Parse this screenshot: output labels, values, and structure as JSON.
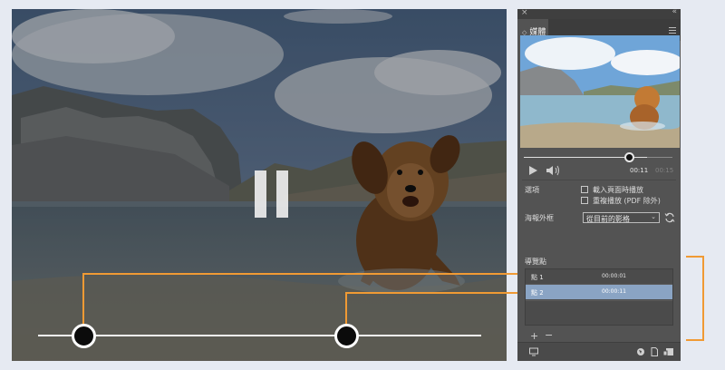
{
  "video": {
    "state": "paused",
    "timeline_markers": [
      {
        "name": "marker-1",
        "position": 0.1
      },
      {
        "name": "marker-2",
        "position": 0.69
      }
    ]
  },
  "panel": {
    "tab_title": "媒體",
    "player": {
      "current_time": "00:11",
      "total_time": "00:15",
      "progress": 0.73
    },
    "options": {
      "label": "選項",
      "checkbox_1": {
        "label": "載入頁面時播放",
        "checked": false
      },
      "checkbox_2": {
        "label": "重複播放 (PDF 除外)",
        "checked": false
      }
    },
    "poster": {
      "label": "海報外框",
      "selected": "從目前的影格"
    },
    "navigation_points": {
      "label": "導覽點",
      "items": [
        {
          "name": "點 1",
          "time": "00:00:01",
          "selected": false
        },
        {
          "name": "點 2",
          "time": "00:00:11",
          "selected": true
        }
      ]
    }
  },
  "colors": {
    "callout": "#f09a34",
    "selection": "#8aa4c4",
    "panel_bg": "#535353"
  },
  "icons": [
    "close-icon",
    "collapse-icon",
    "panel-menu-icon",
    "play-icon",
    "volume-icon",
    "refresh-icon",
    "add-icon",
    "remove-icon",
    "export-icon",
    "globe-icon",
    "document-icon",
    "media-icon"
  ]
}
